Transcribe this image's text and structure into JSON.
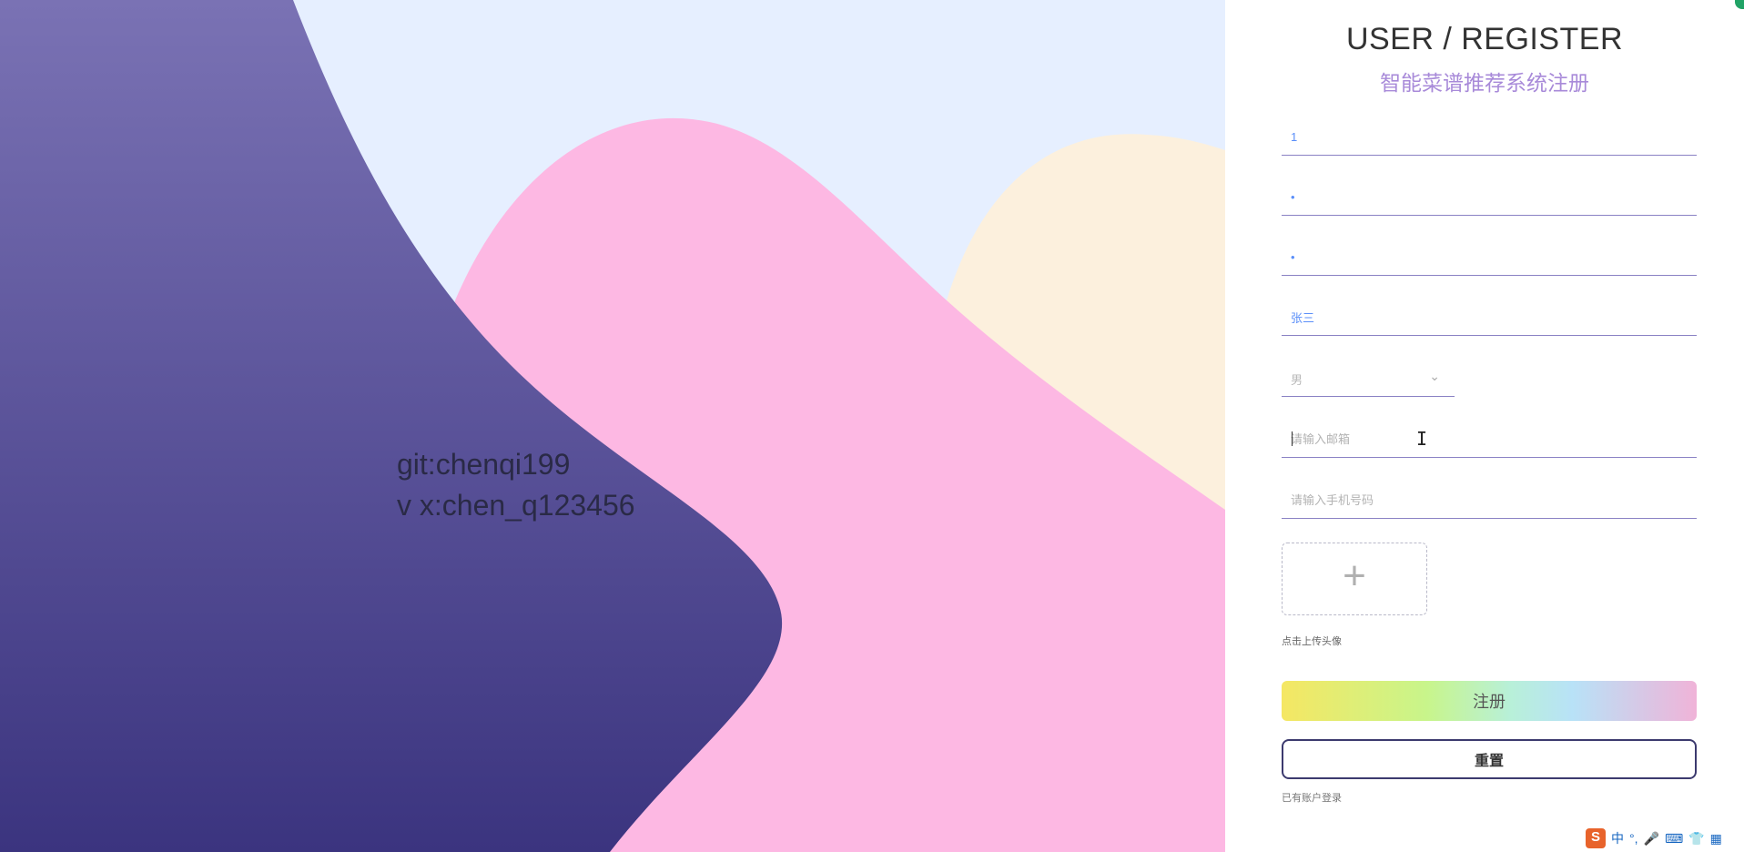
{
  "watermark": {
    "line1": "git:chenqi199",
    "line2": "v x:chen_q123456"
  },
  "header": {
    "title": "USER / REGISTER",
    "subtitle": "智能菜谱推荐系统注册"
  },
  "form": {
    "username_value": "1",
    "password_value": "•",
    "confirm_password_value": "•",
    "realname_value": "张三",
    "gender_value": "男",
    "email_placeholder": "请输入邮箱",
    "phone_placeholder": "请输入手机号码",
    "upload_tip": "点击上传头像",
    "register_label": "注册",
    "reset_label": "重置",
    "login_link": "已有账户登录"
  },
  "colors": {
    "sky": "#e6efff",
    "purple_top": "#7a72b4",
    "purple_bottom": "#3b347f",
    "pink": "#fdb8e3",
    "cream": "#fcf0dd",
    "subtitle": "#a88ad9"
  },
  "icons": {
    "upload": "plus-icon",
    "select": "chevron-down-icon",
    "ime": "sogou-ime-icon"
  },
  "ime": {
    "logo": "S",
    "lang": "中",
    "punct": "°,",
    "mic": "🎤",
    "keyboard": "⌨",
    "skin": "👕",
    "grid": "▦"
  }
}
